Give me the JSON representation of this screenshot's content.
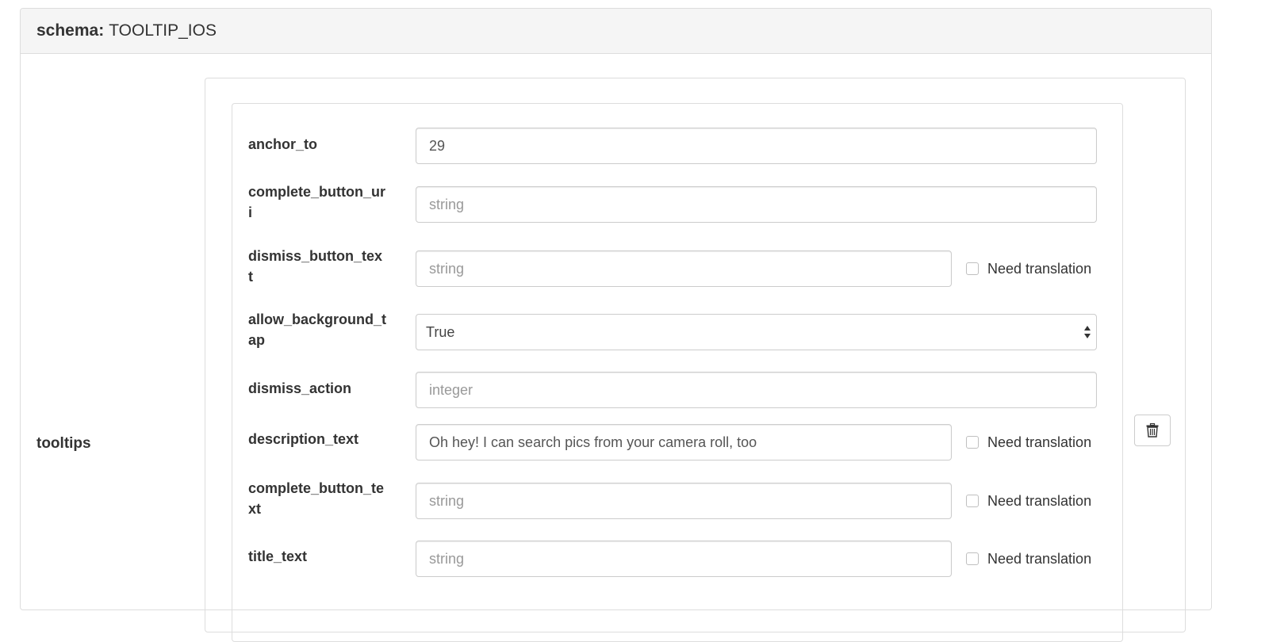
{
  "header": {
    "schema_label": "schema:",
    "schema_value": "TOOLTIP_IOS"
  },
  "section": {
    "label": "tooltips"
  },
  "fields": {
    "anchor_to": {
      "label": "anchor_to",
      "value": "29",
      "placeholder": ""
    },
    "complete_button_uri": {
      "label": "complete_button_uri",
      "value": "",
      "placeholder": "string"
    },
    "dismiss_button_text": {
      "label": "dismiss_button_text",
      "value": "",
      "placeholder": "string",
      "translation_label": "Need translation"
    },
    "allow_background_tap": {
      "label": "allow_background_tap",
      "selected": "True"
    },
    "dismiss_action": {
      "label": "dismiss_action",
      "value": "",
      "placeholder": "integer"
    },
    "description_text": {
      "label": "description_text",
      "value": "Oh hey! I can search pics from your camera roll, too",
      "placeholder": "string",
      "translation_label": "Need translation"
    },
    "complete_button_text": {
      "label": "complete_button_text",
      "value": "",
      "placeholder": "string",
      "translation_label": "Need translation"
    },
    "title_text": {
      "label": "title_text",
      "value": "",
      "placeholder": "string",
      "translation_label": "Need translation"
    }
  },
  "icons": {
    "delete": "trash-icon"
  }
}
